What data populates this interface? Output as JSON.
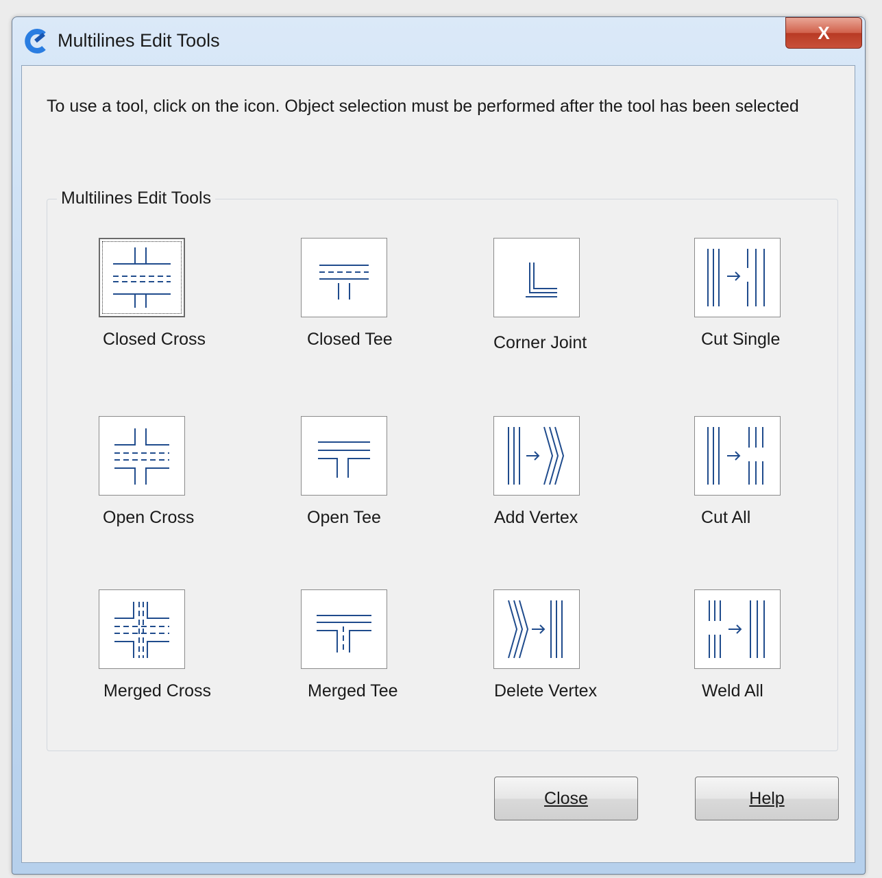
{
  "window": {
    "title": "Multilines Edit Tools",
    "close_glyph": "X",
    "app_icon": "app-logo-icon"
  },
  "instruction": "To use a tool, click on the icon. Object selection must be performed after the tool has been selected",
  "group": {
    "label": "Multilines Edit Tools",
    "tools": [
      {
        "label": "Closed Cross",
        "icon": "closed-cross-icon"
      },
      {
        "label": "Closed Tee",
        "icon": "closed-tee-icon"
      },
      {
        "label": "Corner Joint",
        "icon": "corner-joint-icon"
      },
      {
        "label": "Cut Single",
        "icon": "cut-single-icon"
      },
      {
        "label": "Open Cross",
        "icon": "open-cross-icon"
      },
      {
        "label": "Open Tee",
        "icon": "open-tee-icon"
      },
      {
        "label": "Add Vertex",
        "icon": "add-vertex-icon"
      },
      {
        "label": "Cut All",
        "icon": "cut-all-icon"
      },
      {
        "label": "Merged Cross",
        "icon": "merged-cross-icon"
      },
      {
        "label": "Merged Tee",
        "icon": "merged-tee-icon"
      },
      {
        "label": "Delete Vertex",
        "icon": "delete-vertex-icon"
      },
      {
        "label": "Weld All",
        "icon": "weld-all-icon"
      }
    ]
  },
  "buttons": {
    "close": "Close",
    "help": "Help"
  },
  "colors": {
    "icon_stroke": "#1f4b8c",
    "title_bar": "#c6dcf3",
    "close_button": "#c9513a",
    "client_bg": "#f0f0f0"
  }
}
